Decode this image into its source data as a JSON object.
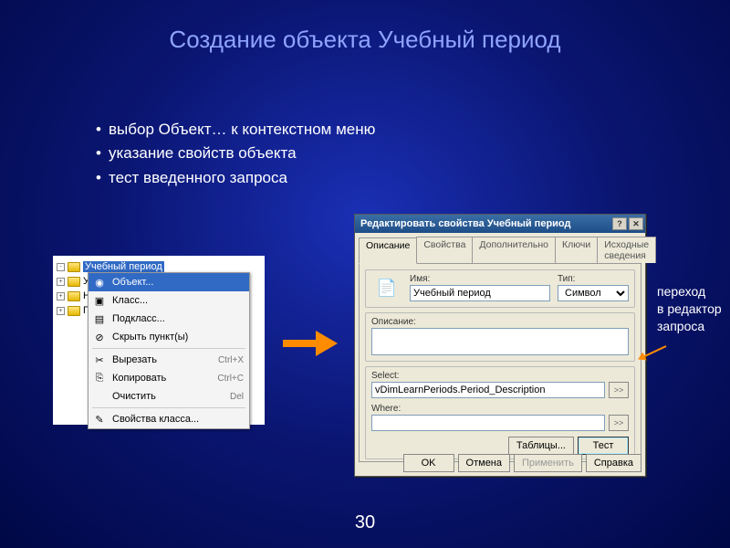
{
  "title": "Создание объекта Учебный период",
  "bullets": [
    "выбор Объект… к контекстном меню",
    "указание свойств объекта",
    "тест введенного запроса"
  ],
  "tree": {
    "items": [
      {
        "label": "Учебный период",
        "expander": "-",
        "selected": true
      },
      {
        "label": "Уче",
        "expander": "+"
      },
      {
        "label": "Нап",
        "expander": "+"
      },
      {
        "label": "Пок",
        "expander": "+"
      }
    ]
  },
  "context_menu": {
    "items": [
      {
        "label": "Объект...",
        "icon": "◉",
        "highlighted": true
      },
      {
        "label": "Класс...",
        "icon": "▣"
      },
      {
        "label": "Подкласс...",
        "icon": "▤"
      },
      {
        "label": "Скрыть пункт(ы)",
        "icon": "⊘"
      }
    ],
    "edit_items": [
      {
        "label": "Вырезать",
        "icon": "✂",
        "shortcut": "Ctrl+X"
      },
      {
        "label": "Копировать",
        "icon": "⎘",
        "shortcut": "Ctrl+C"
      },
      {
        "label": "Очистить",
        "icon": "",
        "shortcut": "Del"
      }
    ],
    "last": {
      "label": "Свойства класса...",
      "icon": "✎"
    }
  },
  "dialog": {
    "title": "Редактировать свойства Учебный период",
    "close_btns": {
      "help": "?",
      "close": "✕"
    },
    "tabs": [
      "Описание",
      "Свойства",
      "Дополнительно",
      "Ключи",
      "Исходные сведения"
    ],
    "active_tab": 0,
    "labels": {
      "name": "Имя:",
      "type": "Тип:",
      "description": "Описание:",
      "select": "Select:",
      "where": "Where:"
    },
    "fields": {
      "name_value": "Учебный период",
      "type_value": "Символ",
      "description_value": "",
      "select_value": "vDimLearnPeriods.Period_Description",
      "where_value": ""
    },
    "mini_btn": ">>",
    "buttons": {
      "tables": "Таблицы...",
      "test": "Тест",
      "ok": "OK",
      "cancel": "Отмена",
      "apply": "Применить",
      "help": "Справка"
    }
  },
  "annotation": {
    "line1": "переход",
    "line2": "в редактор",
    "line3": "запроса"
  },
  "page_number": "30"
}
